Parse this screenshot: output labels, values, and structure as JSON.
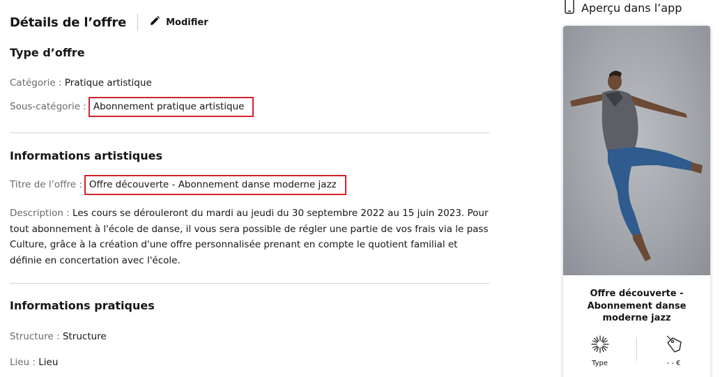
{
  "header": {
    "title": "Détails de l’offre",
    "edit_label": "Modifier"
  },
  "sections": {
    "type": {
      "title": "Type d’offre",
      "category_label": "Catégorie : ",
      "category_value": "Pratique artistique",
      "subcategory_label": "Sous-catégorie :",
      "subcategory_value": "Abonnement pratique artistique"
    },
    "artistic": {
      "title": "Informations artistiques",
      "offer_title_label": "Titre de l’offre :",
      "offer_title_value": "Offre découverte - Abonnement danse moderne jazz",
      "description_label": "Description : ",
      "description_value": "Les cours se dérouleront du mardi au jeudi du 30 septembre 2022 au 15 juin 2023. Pour tout abonnement à l'école de danse, il vous sera possible de régler une partie de vos frais via le pass Culture, grâce à la création d'une offre personnalisée prenant en compte le quotient familial et définie en concertation avec l'école."
    },
    "practical": {
      "title": "Informations pratiques",
      "structure_label": "Structure : ",
      "structure_value": "Structure",
      "location_label": "Lieu : ",
      "location_value": "Lieu"
    }
  },
  "preview": {
    "title": "Aperçu dans l’app",
    "card_title": "Offre découverte - Abonnement danse moderne jazz",
    "type_label": "Type",
    "price_label": "- - €"
  },
  "colors": {
    "highlight_border": "#d2232a",
    "label_grey": "#696a6f",
    "divider": "#d4d4d4"
  },
  "icons": {
    "edit": "pencil-icon",
    "phone": "phone-icon",
    "type": "sparkle-icon",
    "price": "price-tag-icon"
  }
}
